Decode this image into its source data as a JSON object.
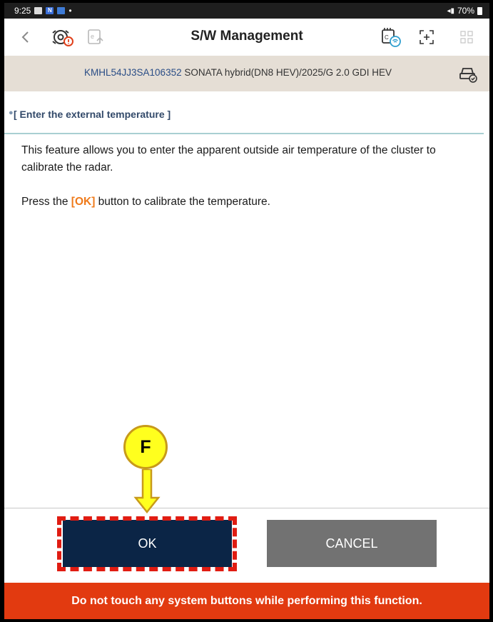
{
  "status_bar": {
    "time": "9:25",
    "battery": "70%",
    "icons": [
      "gallery-icon",
      "news-icon",
      "samsung-app-icon",
      "dot-icon",
      "wifi-signal-icon",
      "battery-icon"
    ]
  },
  "header": {
    "title": "S/W Management",
    "buttons": [
      "back-icon",
      "diagnosis-alert-icon",
      "ecu-upload-icon",
      "vci-wireless-icon",
      "fullscreen-icon",
      "grid-menu-icon"
    ]
  },
  "vehicle": {
    "vin": "KMHL54JJ3SA106352",
    "description": "SONATA hybrid(DN8 HEV)/2025/G 2.0 GDI HEV",
    "icon": "vehicle-check-icon"
  },
  "section": {
    "title": "[ Enter the external temperature ]"
  },
  "content": {
    "line1": "This feature allows you to enter the apparent outside air temperature of the cluster to calibrate the radar.",
    "line2_before": "Press the ",
    "line2_highlight": "[OK]",
    "line2_after": " button to calibrate the temperature."
  },
  "buttons": {
    "ok": "OK",
    "cancel": "CANCEL"
  },
  "warning": "Do not touch any system buttons while performing this function.",
  "callout": {
    "label": "F"
  },
  "colors": {
    "ok_button": "#0b2546",
    "cancel_button": "#727272",
    "warning_bar": "#e23a10",
    "vin_bar": "#e5ded5",
    "highlight": "#ef7a1a",
    "callout_fill": "#ffff1e",
    "dashed_frame": "#e01c12"
  }
}
